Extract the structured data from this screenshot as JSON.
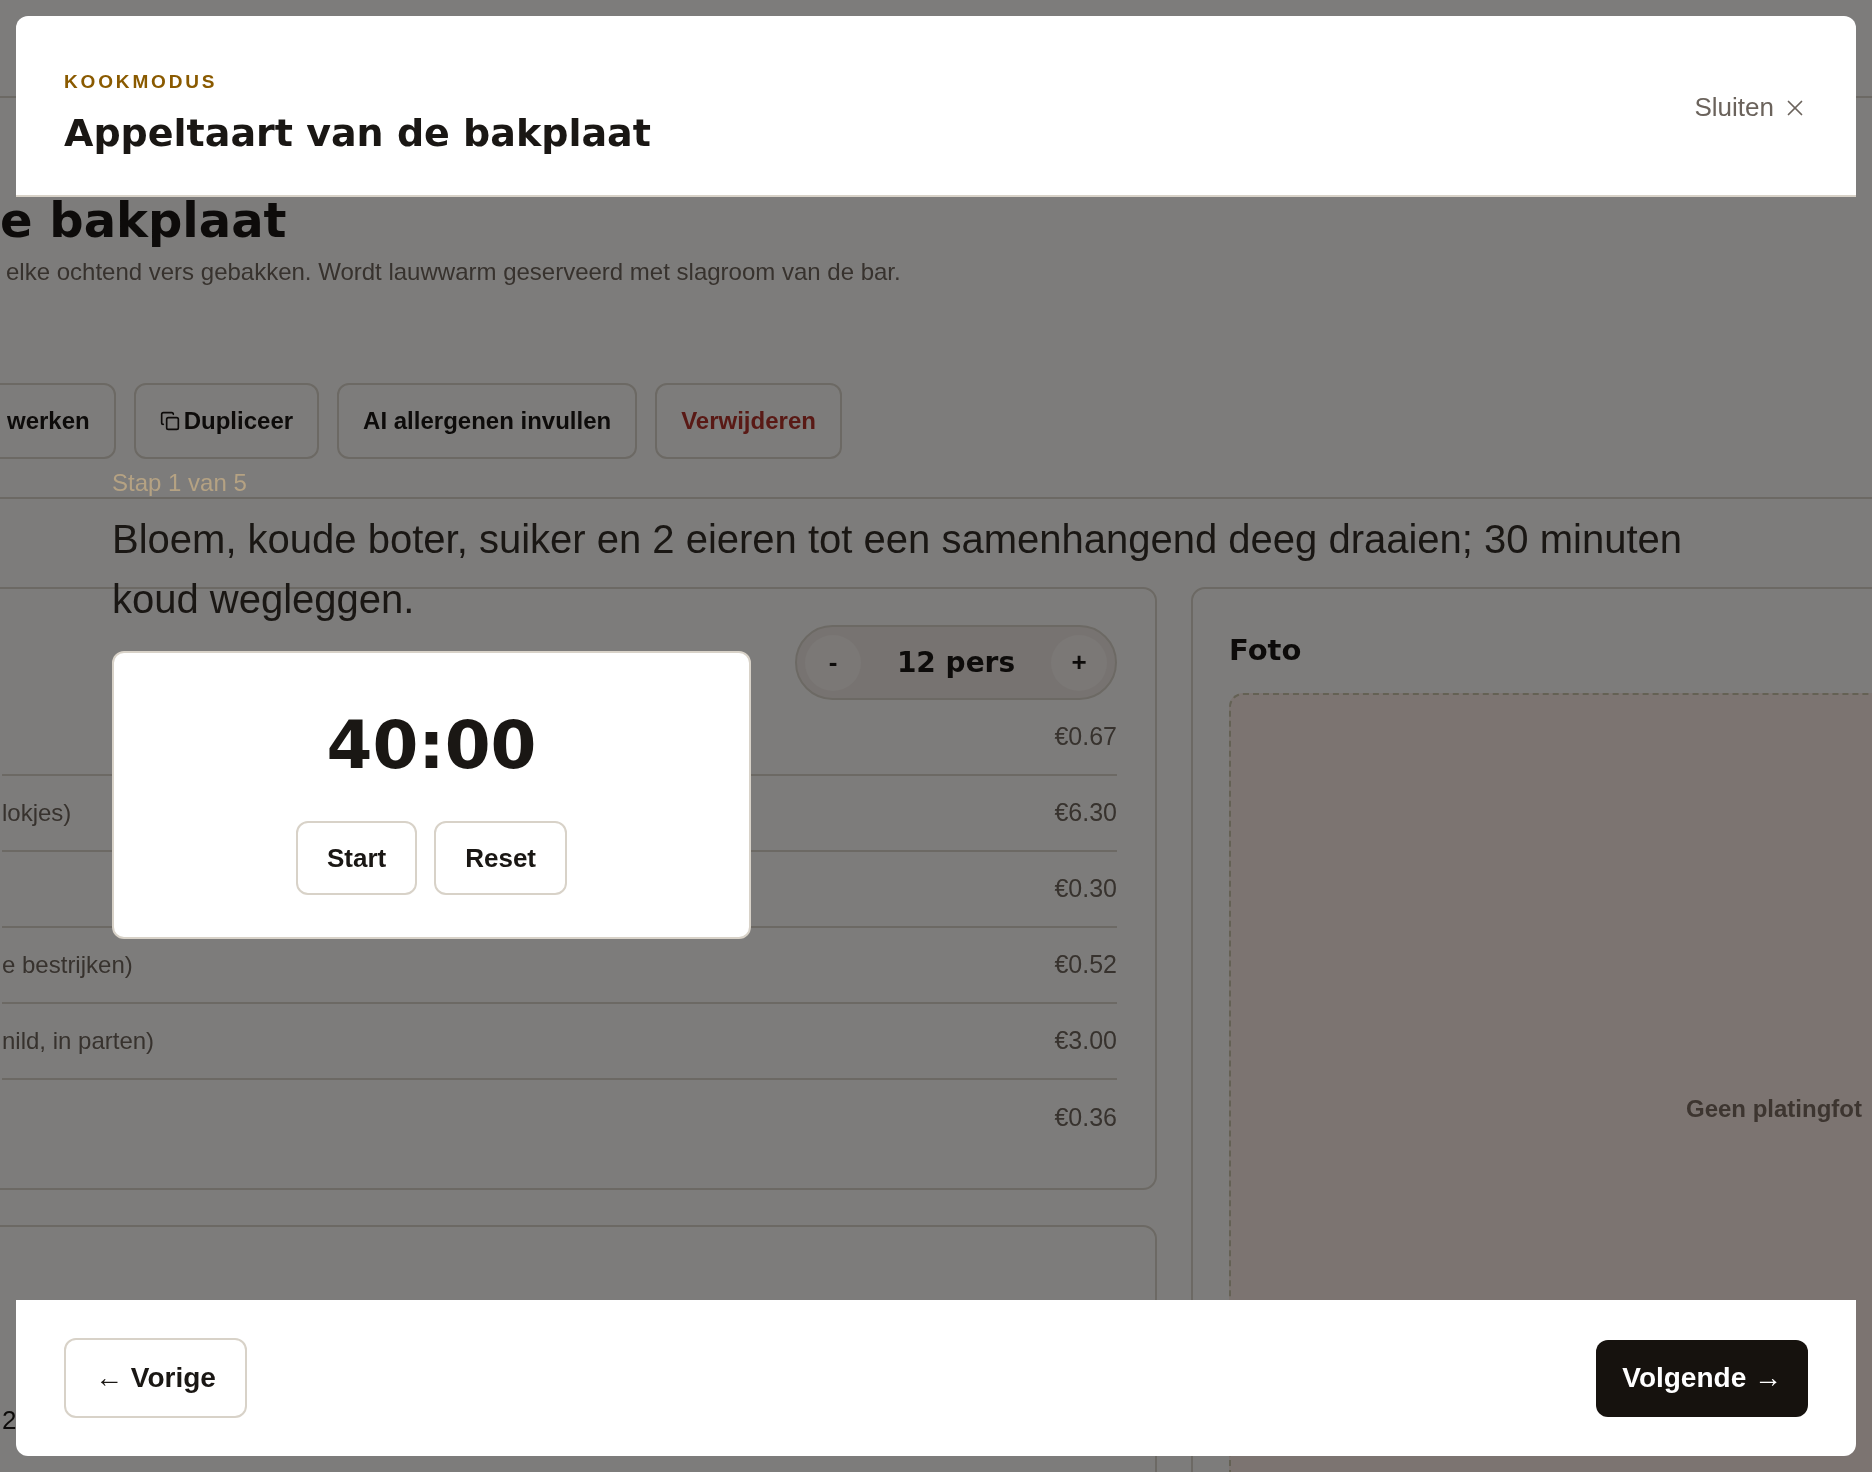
{
  "background_page": {
    "heading": "e bakplaat",
    "description": "elke ochtend vers gebakken. Wordt lauwwarm geserveerd met slagroom van de bar.",
    "actions": [
      {
        "label": "werken",
        "kind": "plain"
      },
      {
        "label": "Dupliceer",
        "kind": "copy"
      },
      {
        "label": "AI allergenen invullen",
        "kind": "plain"
      },
      {
        "label": "Verwijderen",
        "kind": "danger"
      }
    ],
    "servings": {
      "decrement": "-",
      "value": "12 pers",
      "increment": "+"
    },
    "ingredients": [
      {
        "cost": "€0.67"
      },
      {
        "name": "lokjes)",
        "cost": "€6.30"
      },
      {
        "cost": "€0.30"
      },
      {
        "name": "e bestrijken)",
        "cost": "€0.52"
      },
      {
        "name": "nild, in parten)",
        "cost": "€3.00"
      },
      {
        "cost": "€0.36"
      }
    ],
    "photo_card": {
      "title": "Foto",
      "empty_text": "Geen platingfot"
    },
    "lower_card_text": "2"
  },
  "cook_mode": {
    "eyebrow": "KOOKMODUS",
    "title": "Appeltaart van de bakplaat",
    "close": "Sluiten",
    "step_counter": "Stap 1 van 5",
    "step_text": "Bloem, koude boter, suiker en 2 eieren tot een samenhangend deeg draaien; 30 minuten koud wegleggen.",
    "timer": {
      "display": "40:00",
      "buttons": [
        "Start",
        "Reset"
      ]
    },
    "previous": "← Vorige",
    "next": "Volgende →"
  }
}
